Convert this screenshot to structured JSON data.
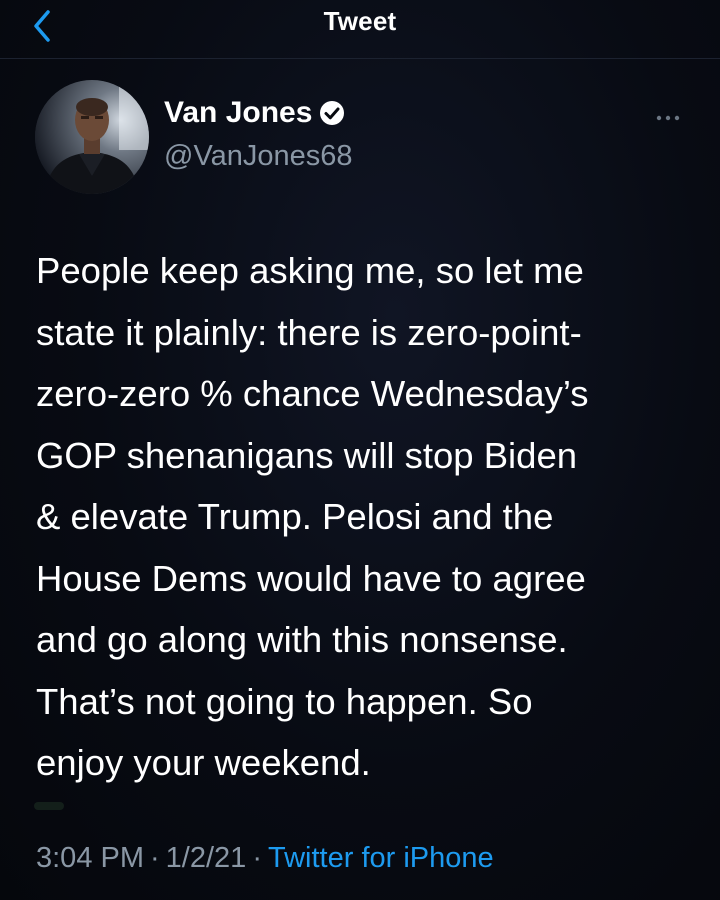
{
  "header": {
    "title": "Tweet",
    "back_icon": "chevron-left-icon"
  },
  "tweet": {
    "author_name": "Van Jones",
    "author_handle": "@VanJones68",
    "verified": true,
    "text": "People keep asking me, so let me\nstate it plainly: there is zero-point-\nzero-zero % chance Wednesday’s\nGOP shenanigans will stop Biden\n& elevate Trump. Pelosi and the\nHouse Dems would have to agree\nand go along with this nonsense.\nThat’s not going to happen. So\nenjoy your weekend.",
    "time": "3:04 PM",
    "date": "1/2/21",
    "separator": "·",
    "source": "Twitter for iPhone"
  },
  "colors": {
    "background": "#07090f",
    "accent": "#1d9bf0",
    "secondary_text": "#8a97a5",
    "primary_text": "#ffffff"
  }
}
